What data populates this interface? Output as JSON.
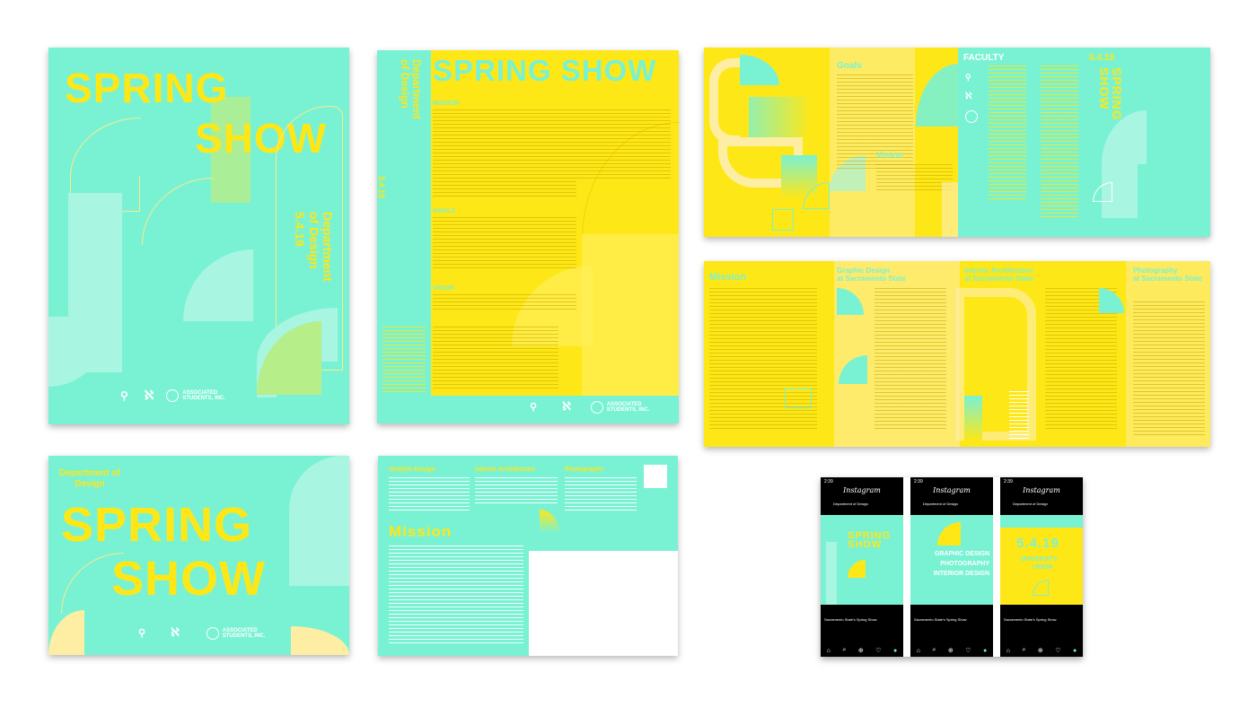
{
  "colors": {
    "mint": "#79f2d3",
    "yellow": "#fee717",
    "cream": "#fdeea4",
    "lime": "#b6ee8a",
    "black": "#000000"
  },
  "poster": {
    "title_line1": "SPRING",
    "title_line2": "SHOW",
    "dept_line1": "Department",
    "dept_line2": "of Design",
    "date": "5.4.19",
    "associated_line1": "ASSOCIATED",
    "associated_line2": "STUDENTS, INC."
  },
  "brochure": {
    "title": "SPRING SHOW",
    "dept_line1": "Department",
    "dept_line2": "of Design",
    "date": "5.4.19",
    "mission": "MISSION",
    "goals": "GOALS",
    "vision": "VISION",
    "associated_line1": "ASSOCIATED",
    "associated_line2": "STUDENTS, INC."
  },
  "trifold_top": {
    "goals": "Goals",
    "vision": "Vision",
    "faculty": "FACULTY",
    "date": "5.4.19",
    "spring": "SPRING",
    "show": "SHOW"
  },
  "trifold_bottom": {
    "mission": "Mission",
    "col2_line1": "Graphic Design",
    "col2_line2": "at Sacramento State",
    "col3_line1": "Interior Architecture",
    "col3_line2": "at Sacramento State",
    "col4_line1": "Photography",
    "col4_line2": "at Sacramento State"
  },
  "postcard_front": {
    "dept_line1": "Department of",
    "dept_line2": "Design",
    "title_line1": "SPRING",
    "title_line2": "SHOW",
    "associated_line1": "ASSOCIATED",
    "associated_line2": "STUDENTS, INC."
  },
  "postcard_back": {
    "col1": "Graphic Design",
    "col2": "Interior Architecture",
    "col3": "Photography",
    "mission": "Mission"
  },
  "phones": [
    {
      "time": "2:39",
      "app": "Instagram",
      "account": "Department of Design",
      "post_title1": "SPRING",
      "post_title2": "SHOW",
      "caption": "Sacramento State's Spring Show"
    },
    {
      "time": "2:39",
      "app": "Instagram",
      "account": "Department of Design",
      "post_line1": "GRAPHIC DESIGN",
      "post_line2": "PHOTOGRAPHY",
      "post_line3": "INTERIOR DESIGN",
      "caption": "Sacramento State's Spring Show"
    },
    {
      "time": "2:39",
      "app": "Instagram",
      "account": "Department of Design",
      "post_date": "5.4.19",
      "post_line1": "UNIVERSITY",
      "post_line2": "UNION",
      "caption": "Sacramento State's Spring Show"
    }
  ]
}
